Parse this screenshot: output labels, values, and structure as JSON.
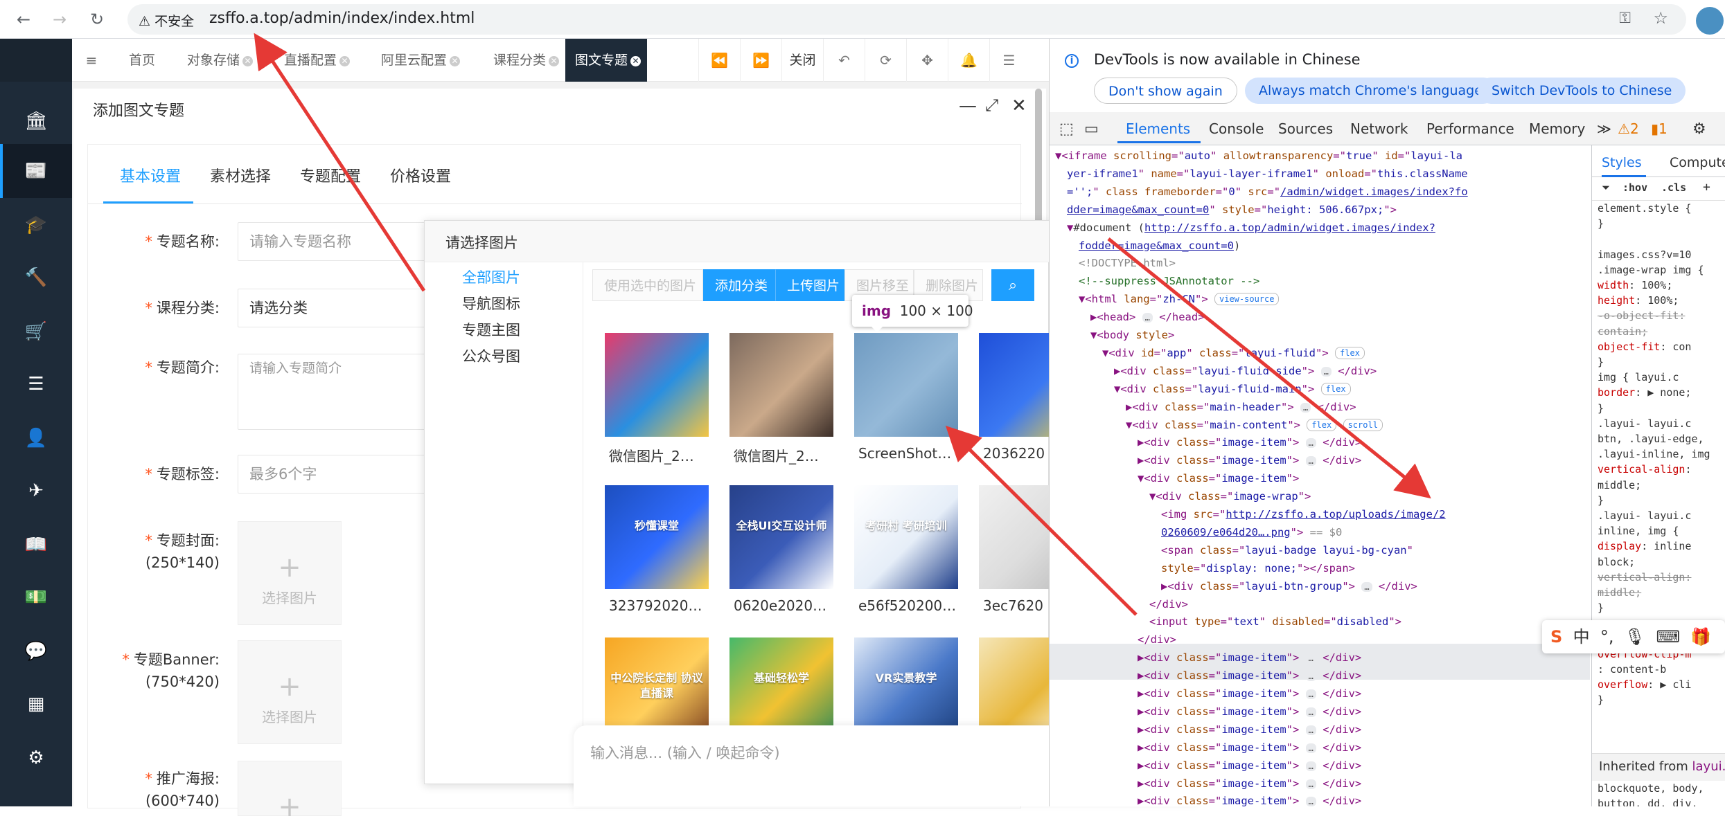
{
  "browser": {
    "insecure_label": "不安全",
    "url": "zsffo.a.top/admin/index/index.html"
  },
  "admin_tabs": [
    {
      "label": "首页"
    },
    {
      "label": "对象存储"
    },
    {
      "label": "直播配置"
    },
    {
      "label": "阿里云配置"
    },
    {
      "label": "课程分类"
    },
    {
      "label": "图文专题"
    }
  ],
  "toolbar": {
    "close_label": "关闭"
  },
  "layer": {
    "title": "添加图文专题"
  },
  "form": {
    "tabs": [
      "基本设置",
      "素材选择",
      "专题配置",
      "价格设置"
    ],
    "fields": {
      "name": {
        "label": "专题名称:",
        "placeholder": "请输入专题名称"
      },
      "category": {
        "label": "课程分类:",
        "value": "请选分类"
      },
      "intro": {
        "label": "专题简介:",
        "placeholder": "请输入专题简介"
      },
      "tags": {
        "label": "专题标签:",
        "placeholder": "最多6个字"
      },
      "cover": {
        "label": "专题封面:",
        "hint": "(250*140)",
        "button": "选择图片"
      },
      "banner": {
        "label": "专题Banner:",
        "hint": "(750*420)",
        "button": "选择图片"
      },
      "poster": {
        "label": "推广海报:",
        "hint": "(600*740)"
      }
    }
  },
  "picker": {
    "title": "请选择图片",
    "categories": [
      "全部图片",
      "导航图标",
      "专题主图",
      "公众号图"
    ],
    "buttons": {
      "use": "使用选中的图片",
      "add_category": "添加分类",
      "upload": "上传图片",
      "move": "图片移至",
      "delete": "删除图片"
    },
    "images": [
      {
        "caption": "微信图片_2…",
        "colors": [
          "#e83a6a",
          "#2a8fe0",
          "#f4c542"
        ]
      },
      {
        "caption": "微信图片_2…",
        "colors": [
          "#7d6a5e",
          "#caa98a",
          "#3c2e28"
        ]
      },
      {
        "caption": "ScreenShot…",
        "colors": [
          "#6f93b3",
          "#a9c2d6",
          "#5a7fa0"
        ]
      },
      {
        "caption": "2036220",
        "colors": [
          "#1f4fd8",
          "#3b78f2",
          "#f0d040"
        ]
      },
      {
        "caption": "323792020…",
        "colors": [
          "#1d4fbf",
          "#2f6bff",
          "#ffd24a"
        ],
        "text": "秒懂课堂"
      },
      {
        "caption": "0620e2020…",
        "colors": [
          "#27418a",
          "#3b5cb8",
          "#ffffff"
        ],
        "text": "全栈UI交互设计师"
      },
      {
        "caption": "e56f520200…",
        "colors": [
          "#ffffff",
          "#e6eef8",
          "#1e3e8a"
        ],
        "text": "考研村 考研培训"
      },
      {
        "caption": "3ec7620",
        "colors": [
          "#f0f0f0",
          "#dddddd",
          "#bbbbbb"
        ]
      },
      {
        "caption": "",
        "colors": [
          "#f6a623",
          "#ffcf5c",
          "#7a3d1e"
        ],
        "text": "中公院长定制 协议直播课"
      },
      {
        "caption": "",
        "colors": [
          "#46b96a",
          "#f1c232",
          "#2e8b57"
        ],
        "text": "基础轻松学"
      },
      {
        "caption": "",
        "colors": [
          "#dfe9f7",
          "#4a79c9",
          "#1b3d7a"
        ],
        "text": "VR实景教学"
      },
      {
        "caption": "",
        "colors": [
          "#f5e6b8",
          "#e8b73a",
          "#ffffff"
        ]
      }
    ]
  },
  "tooltip": {
    "tag": "img",
    "size": "100 × 100"
  },
  "chat": {
    "placeholder": "输入消息... (输入 / 唤起命令)"
  },
  "devtools": {
    "banner": "DevTools is now available in Chinese",
    "buttons": [
      "Don't show again",
      "Always match Chrome's language",
      "Switch DevTools to Chinese"
    ],
    "tabs": [
      "Elements",
      "Console",
      "Sources",
      "Network",
      "Performance",
      "Memory"
    ],
    "warnings": "2",
    "issues": "1",
    "styles_tabs": [
      "Styles",
      "Computed"
    ],
    "filter_hov": ":hov",
    "filter_cls": ".cls",
    "inherited_label": "Inherited from"
  },
  "dom_lines": [
    {
      "indent": 8,
      "html": "▼<span>&lt;iframe</span> <span class=\"an\">scrolling</span>=\"<span class=\"av\">auto</span>\" <span class=\"an\">allowtransparency</span>=\"<span class=\"av\">true</span>\" <span class=\"an\">id</span>=\"<span class=\"av\">layui-la</span>"
    },
    {
      "indent": 9,
      "html": "<span class=\"av\">yer-iframe1</span>\" <span class=\"an\">name</span>=\"<span class=\"av\">layui-layer-iframe1</span>\" <span class=\"an\">onload</span>=\"<span class=\"av\">this.className</span>"
    },
    {
      "indent": 9,
      "html": "<span class=\"av\">='';</span>\" <span class=\"an\">class</span> <span class=\"an\">frameborder</span>=\"<span class=\"av\">0</span>\" <span class=\"an\">src</span>=\"<span class=\"lk\">/admin/widget.images/index?fo</span>"
    },
    {
      "indent": 9,
      "html": "<span class=\"lk\">dder=image&amp;max_count=0</span>\" <span class=\"an\">style</span>=\"<span class=\"av\">height: 506.667px;</span>\"&gt;"
    },
    {
      "indent": 9,
      "html": "▼<span class=\"tx\">#document (</span><span class=\"lk\">http://zsffo.a.top/admin/widget.images/index?</span>"
    },
    {
      "indent": 10,
      "html": "<span class=\"lk\">fodder=image&amp;max_count=0</span><span class=\"tx\">)</span>"
    },
    {
      "indent": 10,
      "html": "<span class=\"tx\" style=\"color:#888\">&lt;!DOCTYPE html&gt;</span>"
    },
    {
      "indent": 10,
      "html": "<span class=\"cm\">&lt;!--suppress JSAnnotator --&gt;</span>"
    },
    {
      "indent": 10,
      "html": "▼&lt;html <span class=\"an\">lang</span>=\"<span class=\"av\">zh-CN</span>\"&gt; <span class=\"badge\">view-source</span>"
    },
    {
      "indent": 11,
      "html": "▶&lt;head&gt; <span class=\"dots\">…</span> &lt;/head&gt;"
    },
    {
      "indent": 11,
      "html": "▼&lt;body <span class=\"an\">style</span>&gt;"
    },
    {
      "indent": 12,
      "html": "▼&lt;div <span class=\"an\">id</span>=\"<span class=\"av\">app</span>\" <span class=\"an\">class</span>=\"<span class=\"av\">layui-fluid</span>\"&gt; <span class=\"badge\">flex</span>"
    },
    {
      "indent": 13,
      "html": "▶&lt;div <span class=\"an\">class</span>=\"<span class=\"av\">layui-fluid-side</span>\"&gt; <span class=\"dots\">…</span> &lt;/div&gt;"
    },
    {
      "indent": 13,
      "html": "▼&lt;div <span class=\"an\">class</span>=\"<span class=\"av\">layui-fluid-main</span>\"&gt; <span class=\"badge\">flex</span>"
    },
    {
      "indent": 14,
      "html": "▶&lt;div <span class=\"an\">class</span>=\"<span class=\"av\">main-header</span>\"&gt; <span class=\"dots\">…</span> &lt;/div&gt;"
    },
    {
      "indent": 14,
      "html": "▼&lt;div <span class=\"an\">class</span>=\"<span class=\"av\">main-content</span>\"&gt; <span class=\"badge\">flex</span> <span class=\"badge\">scroll</span>"
    },
    {
      "indent": 15,
      "html": "▶&lt;div <span class=\"an\">class</span>=\"<span class=\"av\">image-item</span>\"&gt; <span class=\"dots\">…</span> &lt;/div&gt;"
    },
    {
      "indent": 15,
      "html": "▶&lt;div <span class=\"an\">class</span>=\"<span class=\"av\">image-item</span>\"&gt; <span class=\"dots\">…</span> &lt;/div&gt;"
    },
    {
      "indent": 15,
      "html": "▼&lt;div <span class=\"an\">class</span>=\"<span class=\"av\">image-item</span>\"&gt;"
    },
    {
      "indent": 16,
      "html": "▼&lt;div <span class=\"an\">class</span>=\"<span class=\"av\">image-wrap</span>\"&gt;"
    },
    {
      "indent": 17,
      "html": "&lt;img <span class=\"an\">src</span>=\"<span class=\"lk\">http://zsffo.a.top/uploads/image/2</span>"
    },
    {
      "indent": 17,
      "html": "<span class=\"lk\">0260609/e064d20….png</span>\"&gt; <span class=\"tx\" style=\"color:#888\">== $0</span>"
    },
    {
      "indent": 17,
      "html": "&lt;span <span class=\"an\">class</span>=\"<span class=\"av\">layui-badge layui-bg-cyan</span>\""
    },
    {
      "indent": 17,
      "html": "<span class=\"an\">style</span>=\"<span class=\"av\">display: none;</span>\"&gt;&lt;/span&gt;"
    },
    {
      "indent": 17,
      "html": "▶&lt;div <span class=\"an\">class</span>=\"<span class=\"av\">layui-btn-group</span>\"&gt; <span class=\"dots\">…</span> &lt;/div&gt;"
    },
    {
      "indent": 16,
      "html": "&lt;/div&gt;"
    },
    {
      "indent": 16,
      "html": "&lt;input <span class=\"an\">type</span>=\"<span class=\"av\">text</span>\" <span class=\"an\">disabled</span>=\"<span class=\"av\">disabled</span>\"&gt;"
    },
    {
      "indent": 15,
      "html": "&lt;/div&gt;"
    },
    {
      "indent": 15,
      "html": "▶&lt;div <span class=\"an\">class</span>=\"<span class=\"av\">image-item</span>\"&gt; <span class=\"dots\">…</span> &lt;/div&gt;"
    },
    {
      "indent": 15,
      "html": "▶&lt;div <span class=\"an\">class</span>=\"<span class=\"av\">image-item</span>\"&gt; <span class=\"dots\">…</span> &lt;/div&gt;"
    },
    {
      "indent": 15,
      "html": "▶&lt;div <span class=\"an\">class</span>=\"<span class=\"av\">image-item</span>\"&gt; <span class=\"dots\">…</span> &lt;/div&gt;"
    },
    {
      "indent": 15,
      "html": "▶&lt;div <span class=\"an\">class</span>=\"<span class=\"av\">image-item</span>\"&gt; <span class=\"dots\">…</span> &lt;/div&gt;"
    },
    {
      "indent": 15,
      "html": "▶&lt;div <span class=\"an\">class</span>=\"<span class=\"av\">image-item</span>\"&gt; <span class=\"dots\">…</span> &lt;/div&gt;"
    },
    {
      "indent": 15,
      "html": "▶&lt;div <span class=\"an\">class</span>=\"<span class=\"av\">image-item</span>\"&gt; <span class=\"dots\">…</span> &lt;/div&gt;"
    },
    {
      "indent": 15,
      "html": "▶&lt;div <span class=\"an\">class</span>=\"<span class=\"av\">image-item</span>\"&gt; <span class=\"dots\">…</span> &lt;/div&gt;"
    },
    {
      "indent": 15,
      "html": "▶&lt;div <span class=\"an\">class</span>=\"<span class=\"av\">image-item</span>\"&gt; <span class=\"dots\">…</span> &lt;/div&gt;"
    },
    {
      "indent": 15,
      "html": "▶&lt;div <span class=\"an\">class</span>=\"<span class=\"av\">image-item</span>\"&gt; <span class=\"dots\">…</span> &lt;/div&gt;"
    },
    {
      "indent": 15,
      "html": "▶&lt;div <span class=\"an\">class</span>=\"<span class=\"av\">image-item</span>\"&gt; <span class=\"dots\">…</span> &lt;/div&gt;"
    }
  ],
  "styles_lines": [
    {
      "html": "element.style {"
    },
    {
      "html": "}"
    },
    {
      "html": ""
    },
    {
      "html": "  images.css?v=10"
    },
    {
      "html": ".image-wrap img {"
    },
    {
      "html": "  <span class=\"pr\">width</span>: 100%;"
    },
    {
      "html": "  <span class=\"pr\">height</span>: 100%;"
    },
    {
      "html": "  <s style=\"color:#888\">-o-object-fit:</s>"
    },
    {
      "html": "    <s style=\"color:#888\">contain;</s>"
    },
    {
      "html": "  <span class=\"pr\">object-fit</span>: con"
    },
    {
      "html": "}"
    },
    {
      "html": "img {          layui.c"
    },
    {
      "html": "  <span class=\"pr\">border</span>: ▶ none;"
    },
    {
      "html": "}"
    },
    {
      "html": ".layui-       layui.c"
    },
    {
      "html": "btn, .layui-edge,"
    },
    {
      "html": ".layui-inline, img"
    },
    {
      "html": "  <span class=\"pr\">vertical-align</span>:"
    },
    {
      "html": "    middle;"
    },
    {
      "html": "}"
    },
    {
      "html": ".layui-       layui.c"
    },
    {
      "html": "inline, img {"
    },
    {
      "html": "  <span class=\"pr\">display</span>: inline"
    },
    {
      "html": "    block;"
    },
    {
      "html": "  <s style=\"color:#888\">vertical-align:</s>"
    },
    {
      "html": "    <s style=\"color:#888\">middle;</s>"
    },
    {
      "html": "}"
    },
    {
      "html": ""
    },
    {
      "html": ""
    },
    {
      "html": "  <span class=\"pr\">overflow-clip-m</span>"
    },
    {
      "html": "    : content-b"
    },
    {
      "html": "  <span class=\"pr\">overflow</span>: ▶ cli"
    },
    {
      "html": "}"
    }
  ],
  "colors": {
    "accent": "#1e9fff",
    "sidebar": "#1e2b39",
    "required": "#ff5722",
    "arrow": "#e53935"
  }
}
